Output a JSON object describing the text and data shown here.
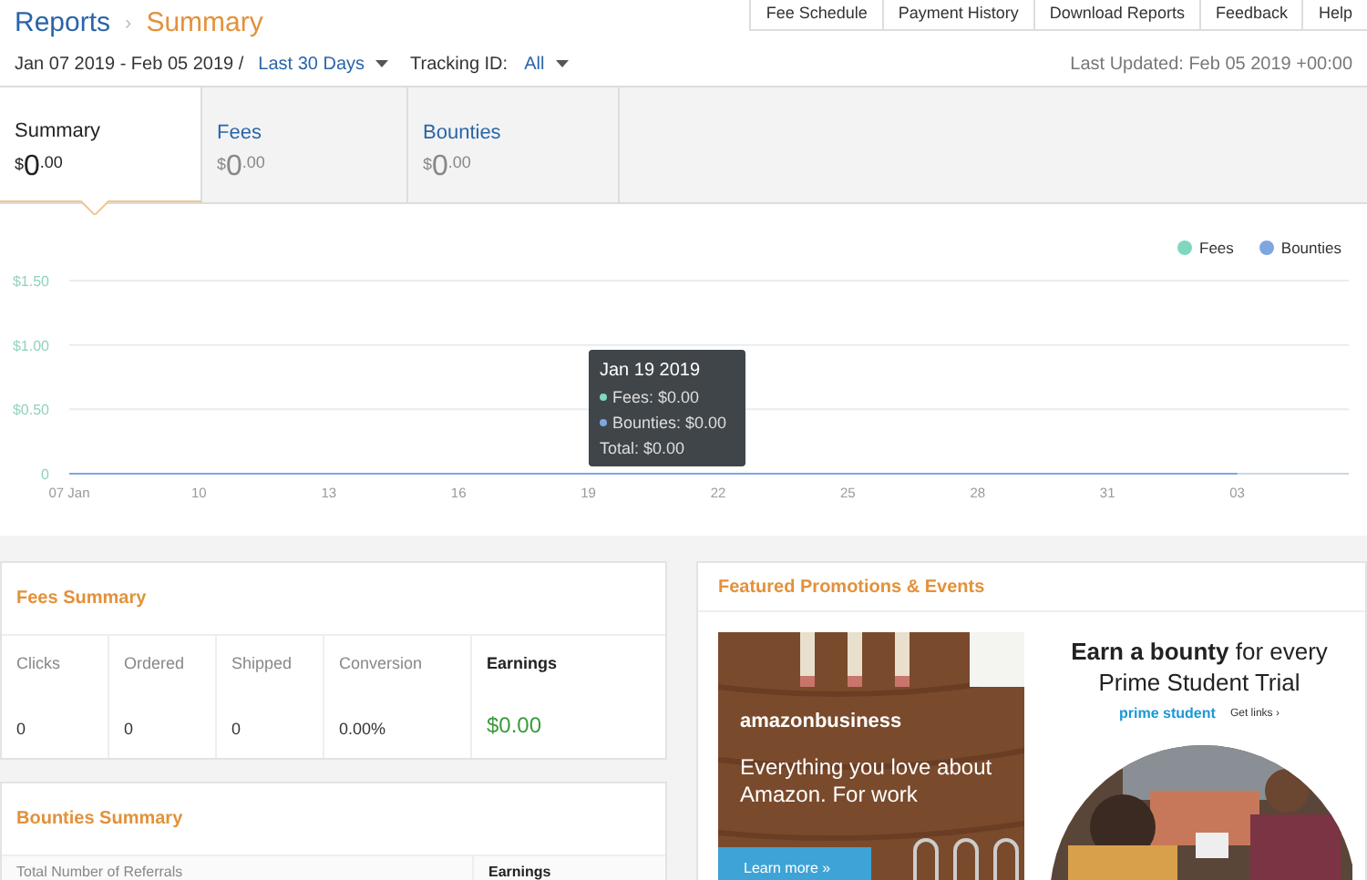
{
  "breadcrumb_separator": "›",
  "breadcrumb": [
    {
      "label": "Reports",
      "selected": false
    },
    {
      "label": "Summary",
      "selected": true
    }
  ],
  "top_links": [
    "Fee Schedule",
    "Payment History",
    "Download Reports",
    "Feedback",
    "Help"
  ],
  "filters": {
    "date_range": "Jan 07 2019 - Feb 05 2019 /",
    "period": "Last 30 Days",
    "tracking_label": "Tracking ID:",
    "tracking_value": "All"
  },
  "last_updated": "Last Updated: Feb 05 2019 +00:00",
  "tabs": [
    {
      "label": "Summary",
      "currency": "$",
      "amount": "0",
      "cents": ".00",
      "selected": true
    },
    {
      "label": "Fees",
      "currency": "$",
      "amount": "0",
      "cents": ".00",
      "selected": false
    },
    {
      "label": "Bounties",
      "currency": "$",
      "amount": "0",
      "cents": ".00",
      "selected": false
    }
  ],
  "chart": {
    "chart_data": {
      "type": "line",
      "categories": [
        "07 Jan",
        "10",
        "13",
        "16",
        "19",
        "22",
        "25",
        "28",
        "31",
        "03"
      ],
      "series": [
        {
          "name": "Fees",
          "color": "#7fd8be",
          "values": [
            null,
            null,
            null,
            null,
            null,
            null,
            null,
            null,
            null,
            null
          ]
        },
        {
          "name": "Bounties",
          "color": "#7ea6e0",
          "values": [
            0,
            0,
            0,
            0,
            0,
            0,
            0,
            0,
            0,
            0
          ]
        }
      ],
      "legend": "top right",
      "ylim": [
        0,
        1.5
      ],
      "yticks": [
        {
          "value": 0,
          "label": "0"
        },
        {
          "value": 0.5,
          "label": "$0.50"
        },
        {
          "value": 1,
          "label": "$1.00"
        },
        {
          "value": 1.5,
          "label": "$1.50"
        }
      ]
    },
    "tooltip": {
      "title": "Jan 19 2019",
      "lines": [
        {
          "text": "Fees: $0.00",
          "color": "#7fd8be"
        },
        {
          "text": "Bounties: $0.00",
          "color": "#7ea6e0"
        }
      ],
      "total": "Total: $0.00"
    }
  },
  "fees_summary": {
    "title": "Fees Summary",
    "columns": [
      "Clicks",
      "Ordered",
      "Shipped",
      "Conversion",
      "Earnings"
    ],
    "values": [
      "0",
      "0",
      "0",
      "0.00%",
      "$0.00"
    ]
  },
  "bounties_summary": {
    "title": "Bounties Summary",
    "columns": [
      "Total Number of Referrals",
      "Earnings"
    ]
  },
  "promotions": {
    "title": "Featured Promotions & Events",
    "banners": [
      {
        "kind": "business",
        "logo": "amazonbusiness",
        "text": "Everything you love about Amazon. For work",
        "button": "Learn more »"
      },
      {
        "kind": "student",
        "headline_bold": "Earn a bounty",
        "headline_rest": "for every Prime Student Trial",
        "logo": "prime student",
        "link": "Get links ›"
      }
    ]
  }
}
